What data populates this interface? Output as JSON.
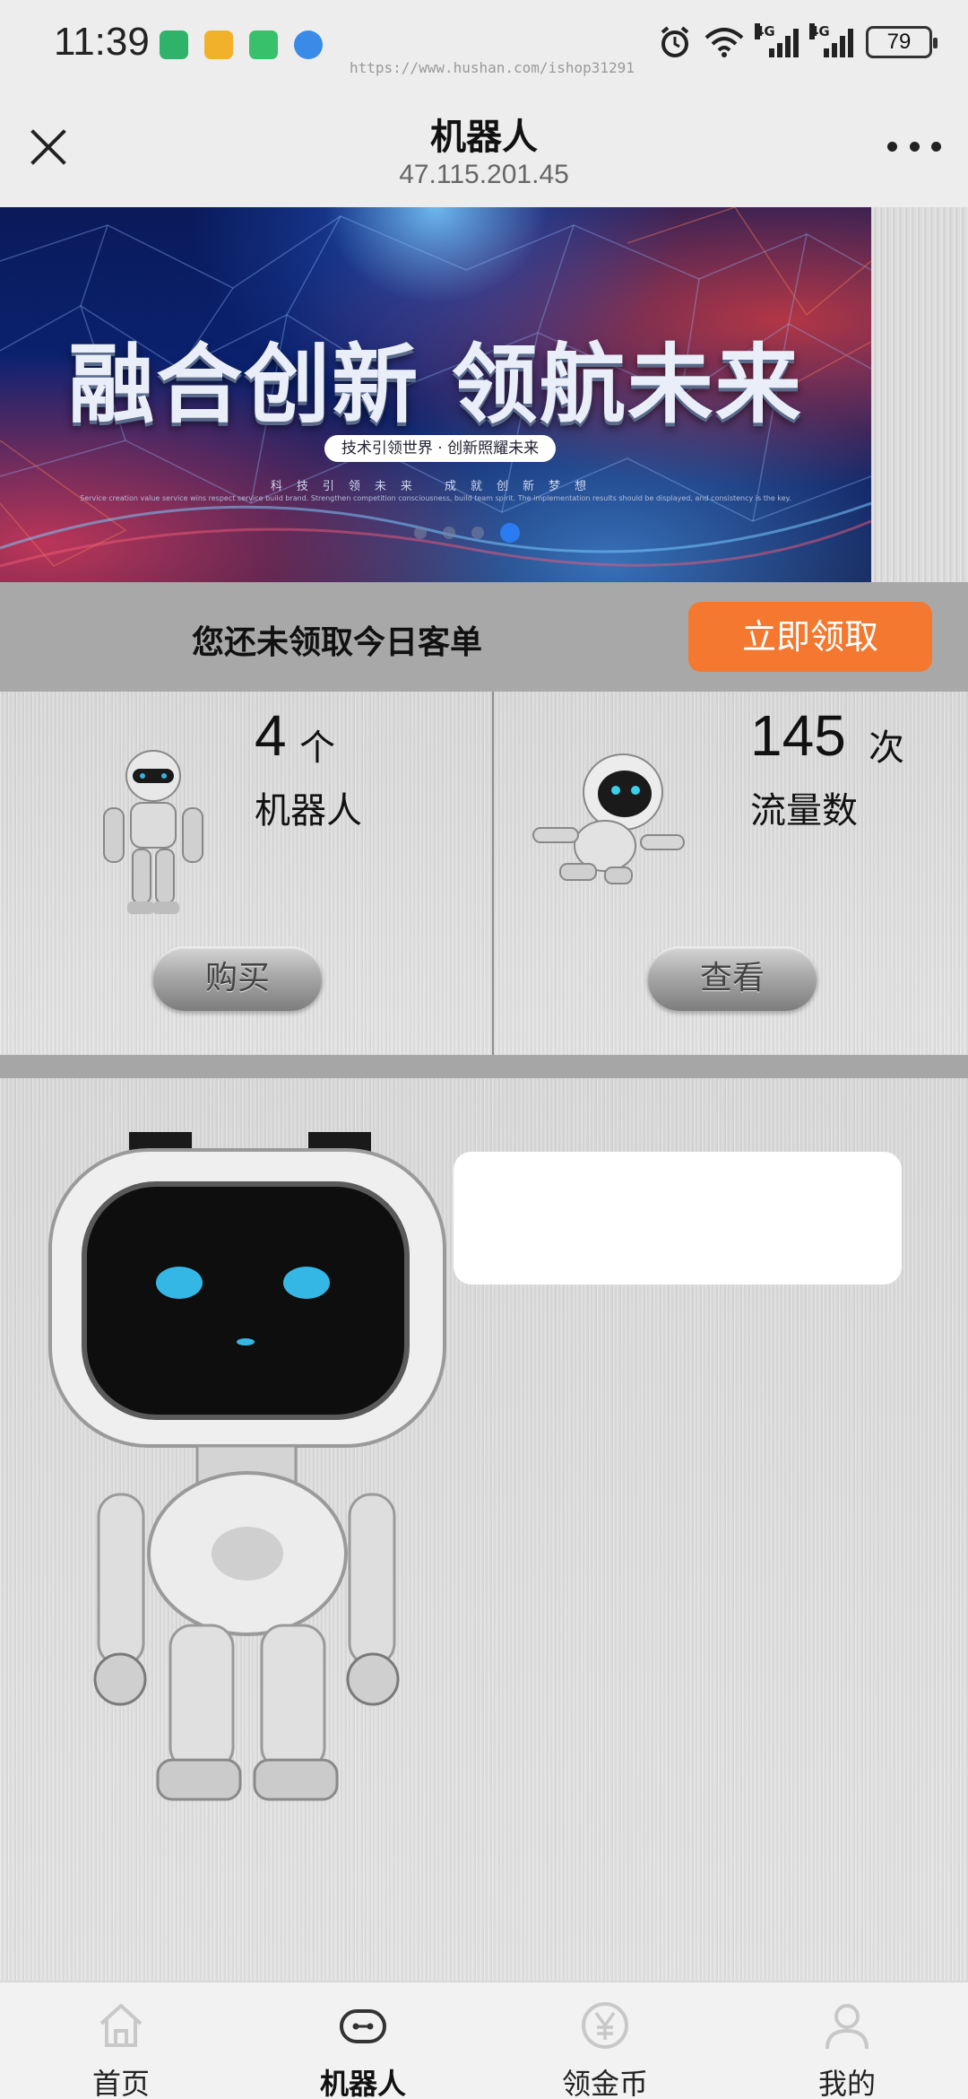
{
  "status_bar": {
    "time": "11:39",
    "watermark": "https://www.hushan.com/ishop31291",
    "battery": "79",
    "network_label": "4G",
    "apps": [
      {
        "name": "hourglass-app-icon",
        "color": "#2fb36a"
      },
      {
        "name": "mail-app-icon",
        "color": "#f2b12a"
      },
      {
        "name": "iqiyi-app-icon",
        "color": "#39c06a"
      },
      {
        "name": "browser-app-icon",
        "color": "#3a8be8"
      }
    ]
  },
  "header": {
    "title": "机器人",
    "subtitle": "47.115.201.45"
  },
  "banner": {
    "headline": "融合创新 领航未来",
    "pill": "技术引领世界 · 创新照耀未来",
    "line1": "科技引领未来  成就创新梦想",
    "line2": "Service creation value service wins respect service build brand. Strengthen competition consciousness, build team spirit. The implementation results should be displayed, and consistency is the key.",
    "colors": {
      "accent": "#2a7cf0"
    }
  },
  "claim": {
    "text": "您还未领取今日客单",
    "button": "立即领取",
    "button_color": "#f4782f"
  },
  "stats": [
    {
      "value": "4",
      "unit": "个",
      "label": "机器人",
      "button": "购买"
    },
    {
      "value": "145",
      "unit": "次",
      "label": "流量数",
      "button": "查看"
    }
  ],
  "nav": [
    {
      "label": "首页",
      "icon": "home-icon",
      "active": false
    },
    {
      "label": "机器人",
      "icon": "robot-icon",
      "active": true
    },
    {
      "label": "领金币",
      "icon": "coin-yen-icon",
      "active": false
    },
    {
      "label": "我的",
      "icon": "user-icon",
      "active": false
    }
  ]
}
